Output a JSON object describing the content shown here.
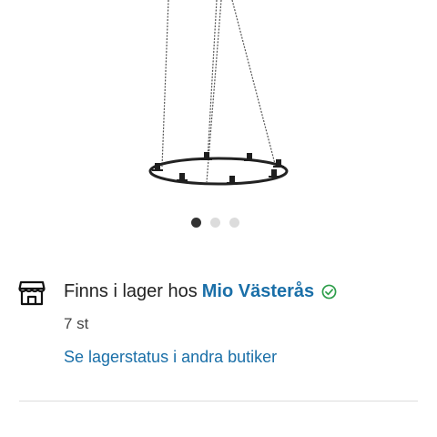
{
  "product": {
    "image_icon": "hanging-candle-ring"
  },
  "carousel": {
    "count": 3,
    "active_index": 0
  },
  "availability": {
    "icon": "store-icon",
    "prefix": "Finns i lager hos",
    "store_name": "Mio Västerås",
    "status_icon": "check-circle-icon",
    "count": "7 st",
    "other_stores_link": "Se lagerstatus i andra butiker"
  },
  "colors": {
    "link": "#1a6fa8",
    "success": "#2e9e4a",
    "text": "#222222"
  }
}
